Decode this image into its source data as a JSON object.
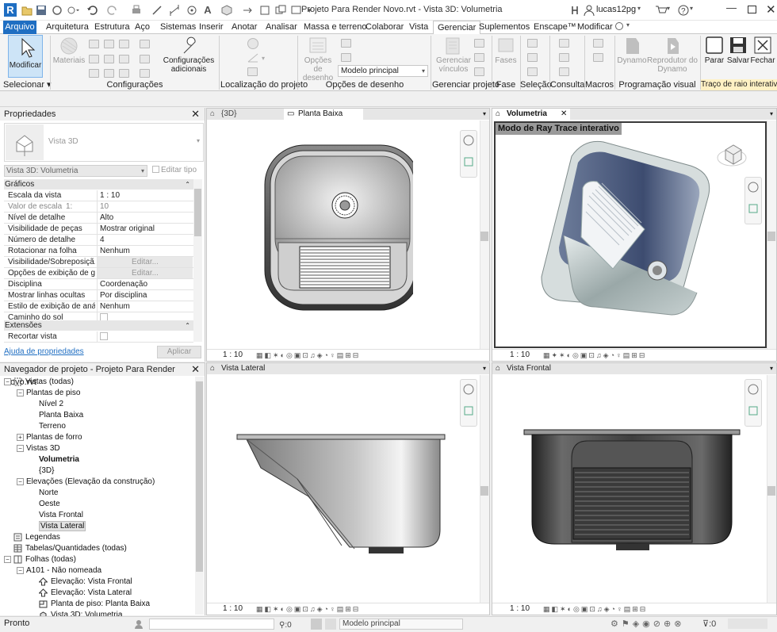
{
  "app": {
    "title": "Projeto Para Render Novo.rvt - Vista 3D: Volumetria",
    "user": "lucas12pg",
    "logo_letter": "R"
  },
  "tabs": [
    "Arquivo",
    "Arquitetura",
    "Estrutura",
    "Aço",
    "Sistemas",
    "Inserir",
    "Anotar",
    "Analisar",
    "Massa e terreno",
    "Colaborar",
    "Vista",
    "Gerenciar",
    "Suplementos",
    "Enscape™",
    "Modificar"
  ],
  "active_tab": "Gerenciar",
  "ribbon": {
    "modify_label": "Modificar",
    "materials_label": "Materiais",
    "config_label": "Configurações adicionais",
    "display_options_label": "Opções de desenho",
    "model_dropdown": "Modelo principal",
    "linked_manage_label": "Gerenciar vínculos",
    "phases_label": "Fases",
    "dynamo_label": "Dynamo",
    "dynamo_player_label": "Reprodutor do Dynamo",
    "stop_label": "Parar",
    "save_label": "Salvar",
    "close_label": "Fechar",
    "panels": [
      "Selecionar ▾",
      "Configurações",
      "Localização do projeto",
      "Opções de desenho",
      "Gerenciar projeto",
      "Fase",
      "Seleção",
      "Consulta",
      "Macros",
      "Programação visual",
      "Traço de raio interativo"
    ]
  },
  "properties": {
    "title": "Propriedades",
    "type_name": "Vista 3D",
    "instance_selector": "Vista 3D: Volumetria",
    "edit_type": "Editar tipo",
    "section_graphics": "Gráficos",
    "rows": [
      {
        "key": "Escala da vista",
        "value": "1 : 10"
      },
      {
        "key": "Valor de escala",
        "value": "10",
        "extra": "1:",
        "readonly": true
      },
      {
        "key": "Nível de detalhe",
        "value": "Alto"
      },
      {
        "key": "Visibilidade de peças",
        "value": "Mostrar original"
      },
      {
        "key": "Número de detalhe",
        "value": "4"
      },
      {
        "key": "Rotacionar na folha",
        "value": "Nenhum"
      },
      {
        "key": "Visibilidade/Sobreposiçã...",
        "value": "Editar...",
        "button": true
      },
      {
        "key": "Opções de exibição de g...",
        "value": "Editar...",
        "button": true
      },
      {
        "key": "Disciplina",
        "value": "Coordenação"
      },
      {
        "key": "Mostrar linhas ocultas",
        "value": "Por disciplina"
      },
      {
        "key": "Estilo de exibição de anál...",
        "value": "Nenhum"
      },
      {
        "key": "Caminho do sol",
        "value": "",
        "check": true
      }
    ],
    "section_extents": "Extensões",
    "crop_row": "Recortar vista",
    "help_link": "Ajuda de propriedades",
    "apply_button": "Aplicar"
  },
  "browser": {
    "title": "Navegador de projeto - Projeto Para Render Novo.rvt",
    "items": [
      {
        "label": "Vistas (todas)",
        "level": 0,
        "expander": "−",
        "icon": "views"
      },
      {
        "label": "Plantas de piso",
        "level": 1,
        "expander": "−"
      },
      {
        "label": "Nível 2",
        "level": 2
      },
      {
        "label": "Planta Baixa",
        "level": 2
      },
      {
        "label": "Terreno",
        "level": 2
      },
      {
        "label": "Plantas de forro",
        "level": 1,
        "expander": "+"
      },
      {
        "label": "Vistas 3D",
        "level": 1,
        "expander": "−"
      },
      {
        "label": "Volumetria",
        "level": 2,
        "bold": true
      },
      {
        "label": "{3D}",
        "level": 2
      },
      {
        "label": "Elevações (Elevação da construção)",
        "level": 1,
        "expander": "−"
      },
      {
        "label": "Norte",
        "level": 2
      },
      {
        "label": "Oeste",
        "level": 2
      },
      {
        "label": "Vista Frontal",
        "level": 2
      },
      {
        "label": "Vista Lateral",
        "level": 2,
        "selected": true
      },
      {
        "label": "Legendas",
        "level": 0,
        "icon": "legend"
      },
      {
        "label": "Tabelas/Quantidades (todas)",
        "level": 0,
        "icon": "table"
      },
      {
        "label": "Folhas (todas)",
        "level": 0,
        "expander": "−",
        "icon": "sheet"
      },
      {
        "label": "A101 - Não nomeada",
        "level": 1,
        "expander": "−"
      },
      {
        "label": "Elevação: Vista Frontal",
        "level": 2,
        "icon": "elev"
      },
      {
        "label": "Elevação: Vista Lateral",
        "level": 2,
        "icon": "elev"
      },
      {
        "label": "Planta de piso: Planta Baixa",
        "level": 2,
        "icon": "plan"
      },
      {
        "label": "Vista 3D: Volumetria",
        "level": 2,
        "icon": "3d"
      }
    ]
  },
  "viewports": {
    "top_left_tabs": [
      "{3D}",
      "Planta Baixa"
    ],
    "top_right_tab": "Volumetria",
    "bottom_left_tab": "Vista Lateral",
    "bottom_right_tab": "Vista Frontal",
    "ray_trace_label": "Modo de Ray Trace interativo",
    "scale": "1 : 10"
  },
  "status": {
    "text": "Pronto",
    "selection_count": ":0",
    "model": "Modelo principal",
    "filter_count": ":0"
  },
  "colors": {
    "accent": "#1f6ec2",
    "active_viewport_border": "#3a3a3a"
  }
}
